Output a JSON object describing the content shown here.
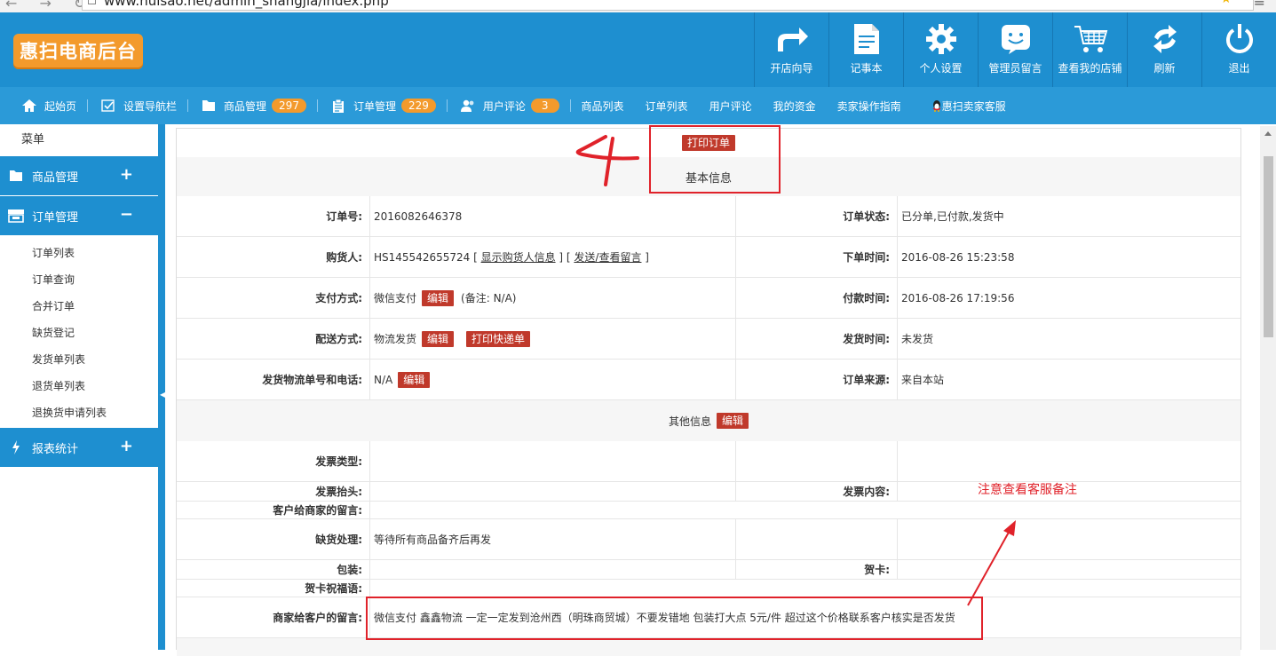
{
  "browser": {
    "url": "www.huisao.net/admin_shangjia/index.php"
  },
  "header": {
    "logo": "惠扫电商后台",
    "tools": [
      {
        "label": "开店向导",
        "icon": "share-arrow-icon"
      },
      {
        "label": "记事本",
        "icon": "notepad-icon"
      },
      {
        "label": "个人设置",
        "icon": "gear-icon"
      },
      {
        "label": "管理员留言",
        "icon": "chat-smile-icon"
      },
      {
        "label": "查看我的店铺",
        "icon": "cart-icon"
      },
      {
        "label": "刷新",
        "icon": "refresh-icon"
      },
      {
        "label": "退出",
        "icon": "power-icon"
      }
    ]
  },
  "nav": {
    "home": "起始页",
    "setnav": "设置导航栏",
    "goods": "商品管理",
    "goods_count": "297",
    "orders": "订单管理",
    "orders_count": "229",
    "comments": "用户评论",
    "comments_count": "3",
    "goods_list": "商品列表",
    "order_list": "订单列表",
    "user_comments": "用户评论",
    "funds": "我的资金",
    "guide": "卖家操作指南",
    "service": "惠扫卖家客服"
  },
  "sidebar": {
    "title": "菜单",
    "groups": [
      {
        "label": "商品管理",
        "toggle": "+"
      },
      {
        "label": "订单管理",
        "toggle": "−"
      },
      {
        "label": "报表统计",
        "toggle": "+"
      }
    ],
    "order_items": [
      "订单列表",
      "订单查询",
      "合并订单",
      "缺货登记",
      "发货单列表",
      "退货单列表",
      "退换货申请列表"
    ]
  },
  "order": {
    "print_button": "打印订单",
    "basic_info": "基本信息",
    "order_no_label": "订单号:",
    "order_no": "2016082646378",
    "status_label": "订单状态:",
    "status": "已分单,已付款,发货中",
    "buyer_label": "购货人:",
    "buyer_id": "HS145542655724",
    "buyer_show_link": "显示购货人信息",
    "buyer_msg_link": "发送/查看留言",
    "order_time_label": "下单时间:",
    "order_time": "2016-08-26 15:23:58",
    "pay_label": "支付方式:",
    "pay_method": "微信支付",
    "pay_note": "(备注: N/A)",
    "pay_time_label": "付款时间:",
    "pay_time": "2016-08-26 17:19:56",
    "ship_label": "配送方式:",
    "ship_method": "物流发货",
    "print_express": "打印快递单",
    "ship_time_label": "发货时间:",
    "ship_time": "未发货",
    "tracking_label": "发货物流单号和电话:",
    "tracking": "N/A",
    "source_label": "订单来源:",
    "source": "来自本站",
    "edit": "编辑",
    "other_info": "其他信息",
    "invoice_type_label": "发票类型:",
    "invoice_title_label": "发票抬头:",
    "invoice_content_label": "发票内容:",
    "customer_msg_label": "客户给商家的留言:",
    "stockout_label": "缺货处理:",
    "stockout": "等待所有商品备齐后再发",
    "package_label": "包装:",
    "card_label": "贺卡:",
    "card_msg_label": "贺卡祝福语:",
    "merchant_msg_label": "商家给客户的留言:",
    "merchant_msg": "微信支付 鑫鑫物流 一定一定发到沧州西（明珠商贸城）不要发错地 包装打大点 5元/件 超过这个价格联系客户核实是否发货"
  },
  "annotations": {
    "note": "注意查看客服备注",
    "color": "#e0222a"
  }
}
